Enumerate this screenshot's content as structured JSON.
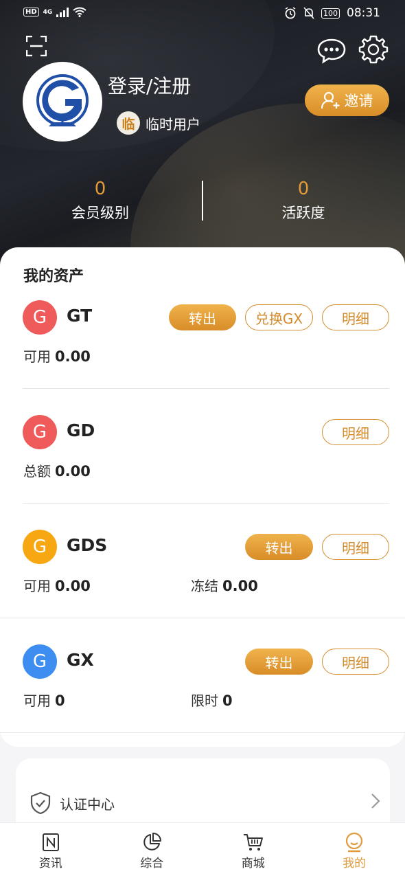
{
  "status": {
    "network": "4G",
    "hd": "HD",
    "battery": "100",
    "time": "08:31"
  },
  "profile": {
    "login_label": "登录/注册",
    "user_type_badge": "临",
    "user_type": "临时用户",
    "invite_label": "邀请"
  },
  "stats": [
    {
      "value": "0",
      "label": "会员级别"
    },
    {
      "value": "0",
      "label": "活跃度"
    }
  ],
  "assets": {
    "title": "我的资产",
    "items": [
      {
        "coin": "G",
        "color": "#ef5b5b",
        "name": "GT",
        "actions": [
          "转出",
          "兑换GX",
          "明细"
        ],
        "balances": [
          {
            "label": "可用",
            "value": "0.00"
          }
        ]
      },
      {
        "coin": "G",
        "color": "#ef5b5b",
        "name": "GD",
        "actions": [
          "明细"
        ],
        "balances": [
          {
            "label": "总额",
            "value": "0.00"
          }
        ]
      },
      {
        "coin": "G",
        "color": "#f7a712",
        "name": "GDS",
        "actions": [
          "转出",
          "明细"
        ],
        "balances": [
          {
            "label": "可用",
            "value": "0.00"
          },
          {
            "label": "冻结",
            "value": "0.00"
          }
        ]
      },
      {
        "coin": "G",
        "color": "#3d8ef0",
        "name": "GX",
        "actions": [
          "转出",
          "明细"
        ],
        "balances": [
          {
            "label": "可用",
            "value": "0"
          },
          {
            "label": "限时",
            "value": "0"
          }
        ]
      }
    ]
  },
  "auth": {
    "label": "认证中心"
  },
  "tabs": [
    {
      "label": "资讯",
      "icon": "news-icon",
      "active": false
    },
    {
      "label": "综合",
      "icon": "pie-chart-icon",
      "active": false
    },
    {
      "label": "商城",
      "icon": "cart-icon",
      "active": false
    },
    {
      "label": "我的",
      "icon": "profile-icon",
      "active": true
    }
  ],
  "colors": {
    "accent": "#e09a3a",
    "button_gradient": [
      "#f0b34c",
      "#d88d28"
    ]
  }
}
